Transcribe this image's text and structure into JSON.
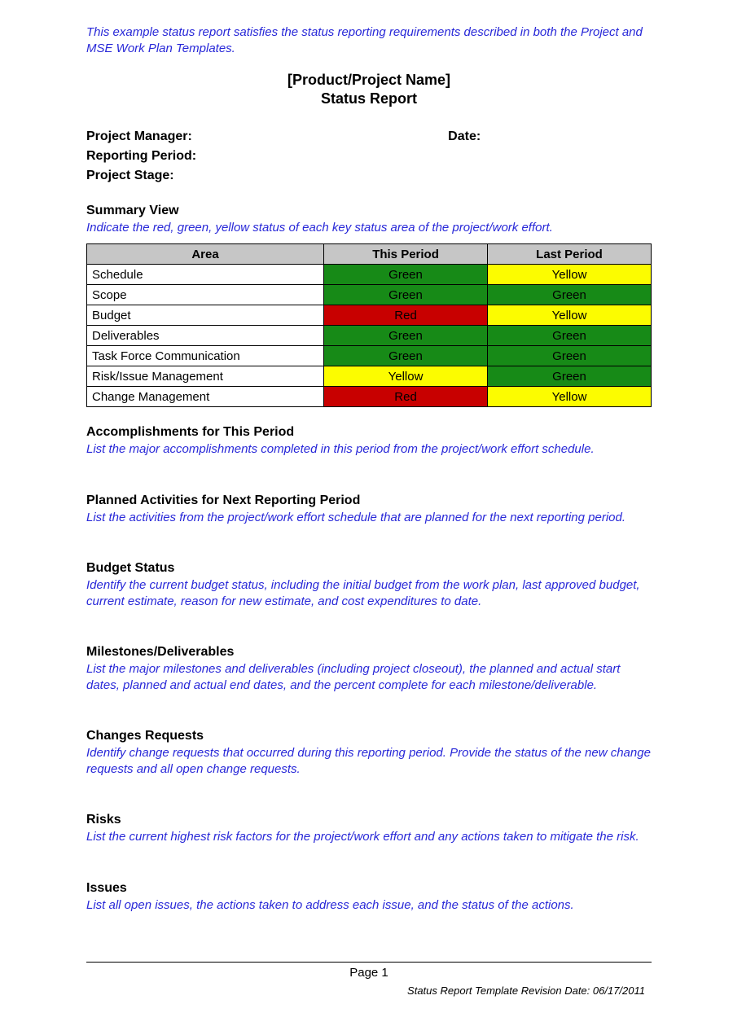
{
  "intro_note": "This example status report satisfies the status reporting requirements described in both the Project and MSE Work Plan Templates.",
  "title_line1": "[Product/Project Name]",
  "title_line2": "Status Report",
  "meta": {
    "project_manager_label": "Project Manager:",
    "date_label": "Date:",
    "reporting_period_label": "Reporting Period:",
    "project_stage_label": "Project Stage:"
  },
  "summary": {
    "heading": "Summary View",
    "note": "Indicate the red, green, yellow status of each key status area of the project/work effort.",
    "columns": {
      "area": "Area",
      "this": "This Period",
      "last": "Last Period"
    },
    "rows": [
      {
        "area": "Schedule",
        "this": "Green",
        "last": "Yellow"
      },
      {
        "area": "Scope",
        "this": "Green",
        "last": "Green"
      },
      {
        "area": "Budget",
        "this": "Red",
        "last": "Yellow"
      },
      {
        "area": "Deliverables",
        "this": "Green",
        "last": "Green"
      },
      {
        "area": "Task Force Communication",
        "this": "Green",
        "last": "Green"
      },
      {
        "area": "Risk/Issue Management",
        "this": "Yellow",
        "last": "Green"
      },
      {
        "area": "Change Management",
        "this": "Red",
        "last": "Yellow"
      }
    ]
  },
  "sections": [
    {
      "heading": "Accomplishments for This Period",
      "note": "List the major accomplishments completed in this period from the project/work effort schedule."
    },
    {
      "heading": "Planned Activities for Next Reporting Period",
      "note": "List the activities from the project/work effort schedule that are planned for the next reporting period."
    },
    {
      "heading": "Budget Status",
      "note": "Identify the current budget status, including the initial budget from the work plan, last approved budget, current estimate, reason for new estimate, and cost expenditures to date."
    },
    {
      "heading": "Milestones/Deliverables",
      "note": "List the major milestones and deliverables (including project closeout), the planned and actual start dates, planned and actual end dates, and the percent complete for each milestone/deliverable."
    },
    {
      "heading": "Changes Requests",
      "note": "Identify change requests that occurred during this reporting period. Provide the status of the new change requests and all open change requests."
    },
    {
      "heading": "Risks",
      "note": "List the current highest risk factors for the project/work effort and any actions taken to mitigate the risk."
    },
    {
      "heading": "Issues",
      "note": "List all open issues, the actions taken to address each issue, and the status of the actions."
    }
  ],
  "footer": {
    "page_label": "Page 1",
    "revision": "Status Report Template Revision Date: 06/17/2011"
  },
  "status_colors": {
    "Green": "g",
    "Yellow": "y",
    "Red": "r"
  }
}
